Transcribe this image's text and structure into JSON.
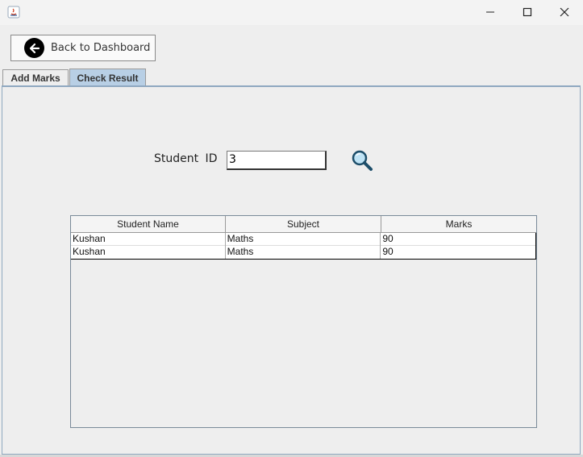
{
  "window": {
    "icons": {
      "app": "java-icon",
      "minimize": "minimize-icon",
      "maximize": "maximize-icon",
      "close": "close-icon"
    }
  },
  "toolbar": {
    "back_label": "Back to Dashboard",
    "back_icon": "arrow-left-circle-icon"
  },
  "tabs": [
    {
      "label": "Add Marks",
      "selected": false
    },
    {
      "label": "Check Result",
      "selected": true
    }
  ],
  "form": {
    "student_id_label": "Student  ID",
    "student_id_value": "3",
    "search_icon": "magnifier-icon"
  },
  "table": {
    "columns": [
      "Student Name",
      "Subject",
      "Marks"
    ],
    "rows": [
      [
        "Kushan",
        "Maths",
        "90"
      ],
      [
        "Kushan",
        "Maths",
        "90"
      ]
    ]
  },
  "colors": {
    "background": "#eeeeee",
    "selected_tab": "#b8cfe5",
    "panel_border": "#8fa8c0"
  }
}
